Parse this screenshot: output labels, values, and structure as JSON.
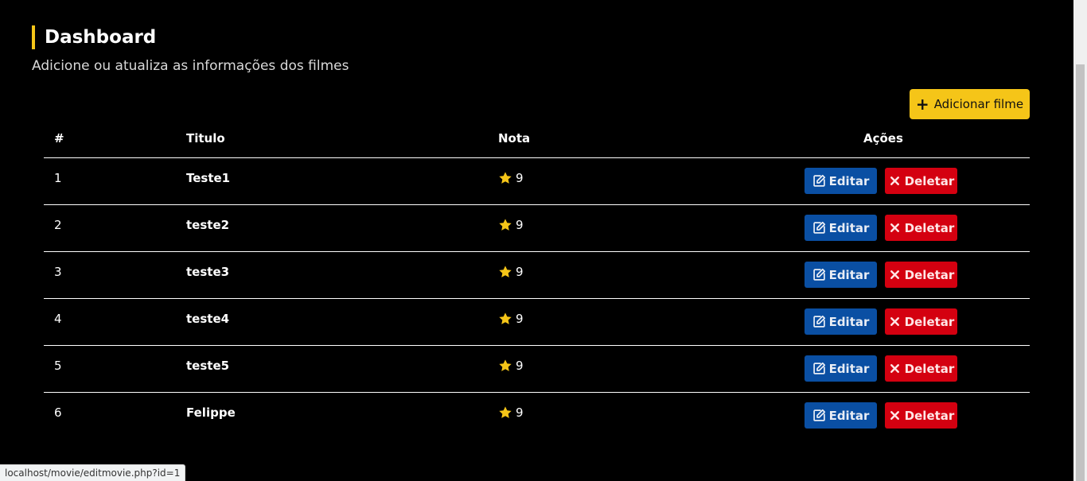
{
  "header": {
    "title": "Dashboard",
    "subtitle": "Adicione ou atualiza as informações dos filmes"
  },
  "toolbar": {
    "add_label": "Adicionar filme"
  },
  "table": {
    "columns": [
      "#",
      "Titulo",
      "Nota",
      "Ações"
    ],
    "rows": [
      {
        "id": "1",
        "title": "Teste1",
        "rating": "9"
      },
      {
        "id": "2",
        "title": "teste2",
        "rating": "9"
      },
      {
        "id": "3",
        "title": "teste3",
        "rating": "9"
      },
      {
        "id": "4",
        "title": "teste4",
        "rating": "9"
      },
      {
        "id": "5",
        "title": "teste5",
        "rating": "9"
      },
      {
        "id": "6",
        "title": "Felippe",
        "rating": "9"
      }
    ],
    "edit_label": "Editar",
    "delete_label": "Deletar"
  },
  "status_bar": {
    "url": "localhost/movie/editmovie.php?id=1"
  },
  "colors": {
    "accent": "#f5c518",
    "edit": "#0a4fa3",
    "delete": "#d40010"
  }
}
